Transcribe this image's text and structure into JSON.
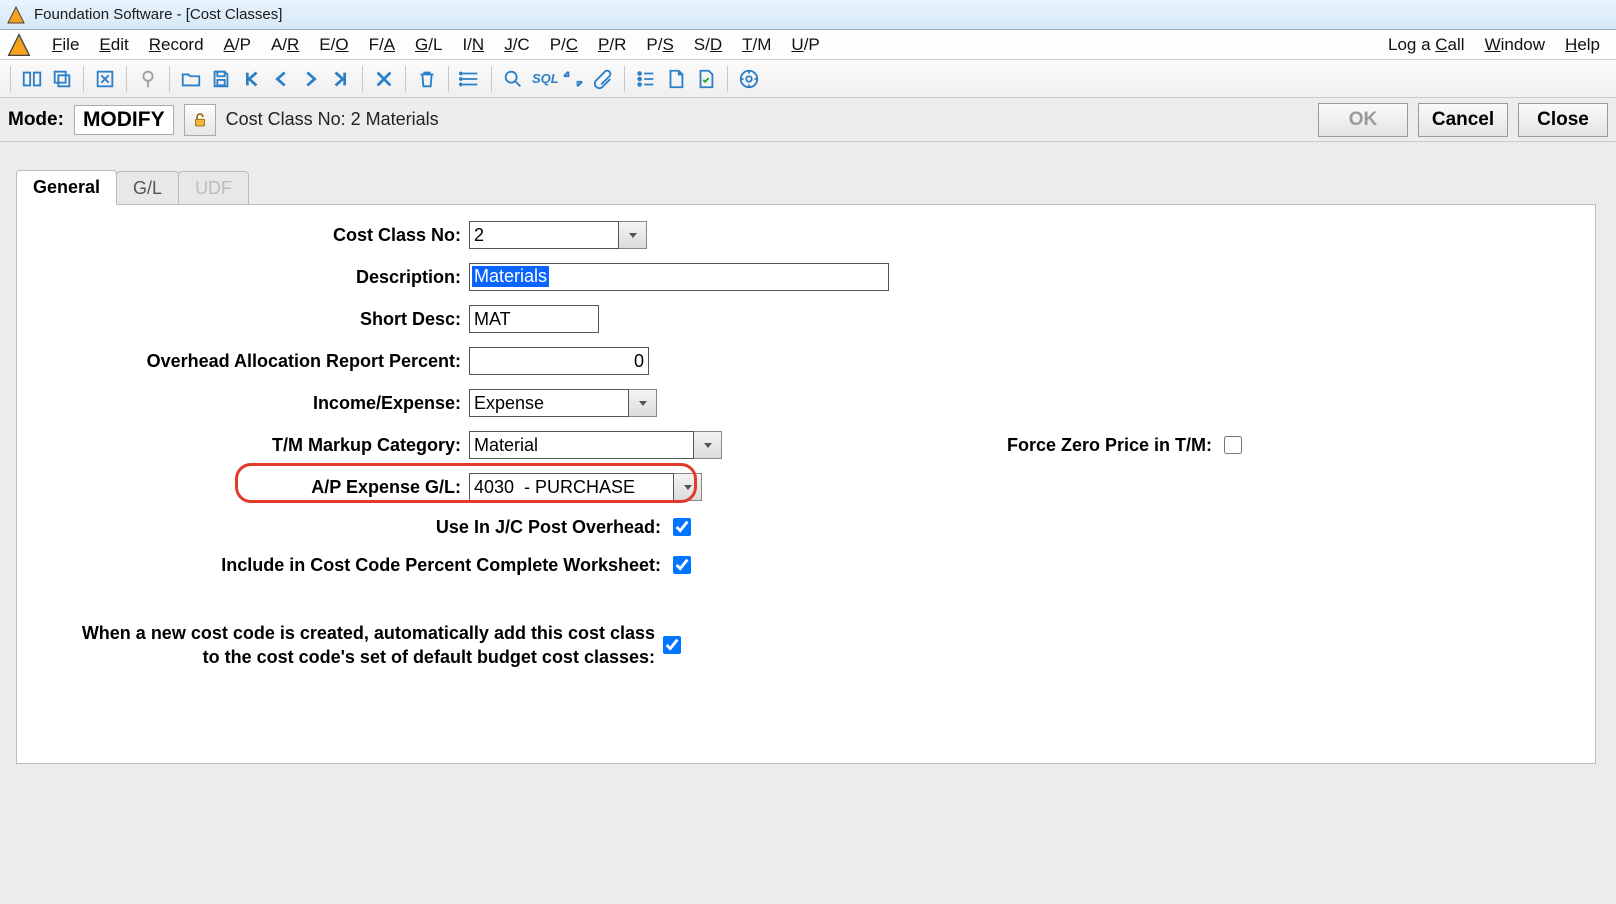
{
  "window": {
    "title": "Foundation Software - [Cost Classes]"
  },
  "menu": {
    "file": "File",
    "edit": "Edit",
    "record": "Record",
    "ap": "A/P",
    "ar": "A/R",
    "eo": "E/O",
    "fa": "F/A",
    "gl": "G/L",
    "in": "I/N",
    "jc": "J/C",
    "pc": "P/C",
    "pr": "P/R",
    "ps": "P/S",
    "sd": "S/D",
    "tm": "T/M",
    "up": "U/P",
    "log_a_call": "Log a Call",
    "window": "Window",
    "help": "Help"
  },
  "mode": {
    "label": "Mode:",
    "value": "MODIFY",
    "context": "Cost Class No: 2  Materials"
  },
  "buttons": {
    "ok": "OK",
    "cancel": "Cancel",
    "close": "Close"
  },
  "tabs": {
    "general": "General",
    "gl": "G/L",
    "udf": "UDF"
  },
  "form": {
    "cost_class_no_label": "Cost Class No:",
    "cost_class_no_value": "2",
    "description_label": "Description:",
    "description_value": "Materials",
    "short_desc_label": "Short Desc:",
    "short_desc_value": "MAT",
    "overhead_label": "Overhead Allocation Report Percent:",
    "overhead_value": "0",
    "income_expense_label": "Income/Expense:",
    "income_expense_value": "Expense",
    "tm_markup_label": "T/M Markup Category:",
    "tm_markup_value": "Material",
    "force_zero_label": "Force Zero Price in T/M:",
    "ap_expense_label": "A/P Expense G/L:",
    "ap_expense_value": "4030  - PURCHASE",
    "use_jc_label": "Use In J/C Post Overhead:",
    "include_worksheet_label": "Include in Cost Code Percent Complete Worksheet:",
    "auto_add_note": "When a new cost code is created, automatically add this cost class\nto the cost code's set of default budget cost classes:"
  }
}
